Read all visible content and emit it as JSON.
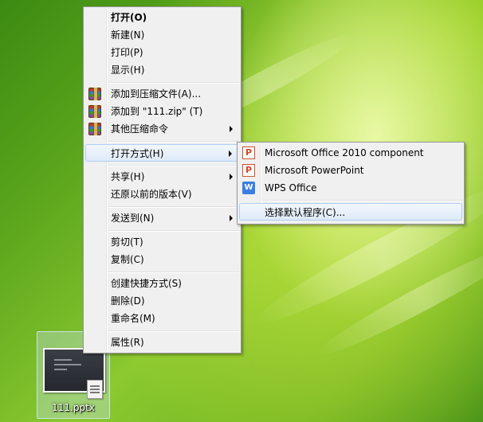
{
  "desktop": {
    "file": {
      "name": "111.pptx"
    }
  },
  "context_menu": {
    "items": [
      {
        "label": "打开(O)",
        "bold": true
      },
      {
        "label": "新建(N)"
      },
      {
        "label": "打印(P)"
      },
      {
        "label": "显示(H)"
      },
      {
        "label": "添加到压缩文件(A)...",
        "icon": "archive-icon"
      },
      {
        "label": "添加到 \"111.zip\" (T)",
        "icon": "archive-icon"
      },
      {
        "label": "其他压缩命令",
        "icon": "archive-icon",
        "submenu": true
      },
      {
        "label": "打开方式(H)",
        "submenu": true,
        "highlighted": true
      },
      {
        "label": "共享(H)",
        "submenu": true
      },
      {
        "label": "还原以前的版本(V)"
      },
      {
        "label": "发送到(N)",
        "submenu": true
      },
      {
        "label": "剪切(T)"
      },
      {
        "label": "复制(C)"
      },
      {
        "label": "创建快捷方式(S)"
      },
      {
        "label": "删除(D)"
      },
      {
        "label": "重命名(M)"
      },
      {
        "label": "属性(R)"
      }
    ]
  },
  "open_with_submenu": {
    "items": [
      {
        "label": "Microsoft Office 2010 component",
        "icon": "powerpoint-icon",
        "icon_text": "P"
      },
      {
        "label": "Microsoft PowerPoint",
        "icon": "powerpoint-icon",
        "icon_text": "P"
      },
      {
        "label": "WPS Office",
        "icon": "wps-icon",
        "icon_text": "W"
      },
      {
        "label": "选择默认程序(C)...",
        "highlighted": true
      }
    ]
  }
}
